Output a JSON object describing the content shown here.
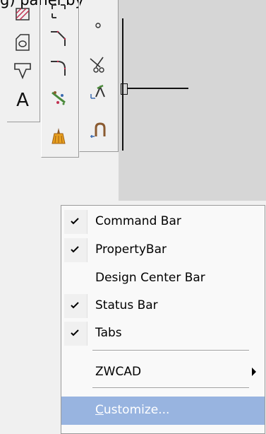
{
  "top_partial_text": "g) panel by",
  "menu": {
    "items": [
      {
        "label": "Command Bar",
        "checked": true
      },
      {
        "label": "PropertyBar",
        "checked": true
      },
      {
        "label": "Design Center Bar",
        "checked": false
      },
      {
        "label": "Status Bar",
        "checked": true
      },
      {
        "label": "Tabs",
        "checked": true
      },
      {
        "label": "ZWCAD",
        "has_submenu": true
      },
      {
        "label_mnemonic": "C",
        "label_rest": "ustomize...",
        "highlighted": true
      }
    ]
  },
  "toolbar": {
    "col1": [
      "hatch-icon",
      "region-icon",
      "table-icon",
      "text-icon"
    ],
    "col1_text_glyph": "A",
    "col2": [
      "rectangle-corner-icon",
      "chamfer-icon",
      "fillet-icon",
      "explode-icon",
      "purge-icon"
    ],
    "col3": [
      "point-icon",
      "trim-icon",
      "extend-icon",
      "break-icon"
    ]
  },
  "colors": {
    "menu_highlight": "#98b4e0",
    "drawing_background": "#d6d6d6"
  }
}
